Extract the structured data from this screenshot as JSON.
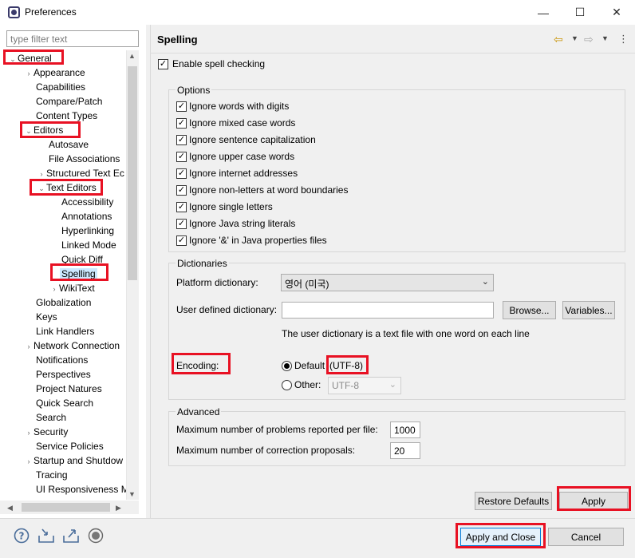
{
  "window": {
    "title": "Preferences",
    "minimize": "—",
    "maximize": "☐",
    "close": "✕"
  },
  "filter": {
    "placeholder": "type filter text"
  },
  "tree": {
    "items": [
      {
        "label": "General"
      },
      {
        "label": "Appearance"
      },
      {
        "label": "Capabilities"
      },
      {
        "label": "Compare/Patch"
      },
      {
        "label": "Content Types"
      },
      {
        "label": "Editors"
      },
      {
        "label": "Autosave"
      },
      {
        "label": "File Associations"
      },
      {
        "label": "Structured Text Ec"
      },
      {
        "label": "Text Editors"
      },
      {
        "label": "Accessibility"
      },
      {
        "label": "Annotations"
      },
      {
        "label": "Hyperlinking"
      },
      {
        "label": "Linked Mode"
      },
      {
        "label": "Quick Diff"
      },
      {
        "label": "Spelling"
      },
      {
        "label": "WikiText"
      },
      {
        "label": "Globalization"
      },
      {
        "label": "Keys"
      },
      {
        "label": "Link Handlers"
      },
      {
        "label": "Network Connection"
      },
      {
        "label": "Notifications"
      },
      {
        "label": "Perspectives"
      },
      {
        "label": "Project Natures"
      },
      {
        "label": "Quick Search"
      },
      {
        "label": "Search"
      },
      {
        "label": "Security"
      },
      {
        "label": "Service Policies"
      },
      {
        "label": "Startup and Shutdow"
      },
      {
        "label": "Tracing"
      },
      {
        "label": "UI Responsiveness M"
      }
    ]
  },
  "page": {
    "title": "Spelling",
    "enable_spell": "Enable spell checking",
    "options": {
      "title": "Options",
      "items": [
        "Ignore words with digits",
        "Ignore mixed case words",
        "Ignore sentence capitalization",
        "Ignore upper case words",
        "Ignore internet addresses",
        "Ignore non-letters at word boundaries",
        "Ignore single letters",
        "Ignore Java string literals",
        "Ignore '&' in Java properties files"
      ]
    },
    "dictionaries": {
      "title": "Dictionaries",
      "platform_label": "Platform dictionary:",
      "platform_value": "영어 (미국)",
      "user_label": "User defined dictionary:",
      "user_value": "",
      "browse": "Browse...",
      "variables": "Variables...",
      "hint": "The user dictionary is a text file with one word on each line",
      "encoding_label": "Encoding:",
      "default_label": "Default",
      "default_value": "(UTF-8)",
      "other_label": "Other:",
      "other_value": "UTF-8"
    },
    "advanced": {
      "title": "Advanced",
      "max_problems_label": "Maximum number of problems reported per file:",
      "max_problems_value": "1000",
      "max_proposals_label": "Maximum number of correction proposals:",
      "max_proposals_value": "20"
    },
    "restore_defaults": "Restore Defaults",
    "apply": "Apply"
  },
  "footer": {
    "apply_close": "Apply and Close",
    "cancel": "Cancel"
  }
}
